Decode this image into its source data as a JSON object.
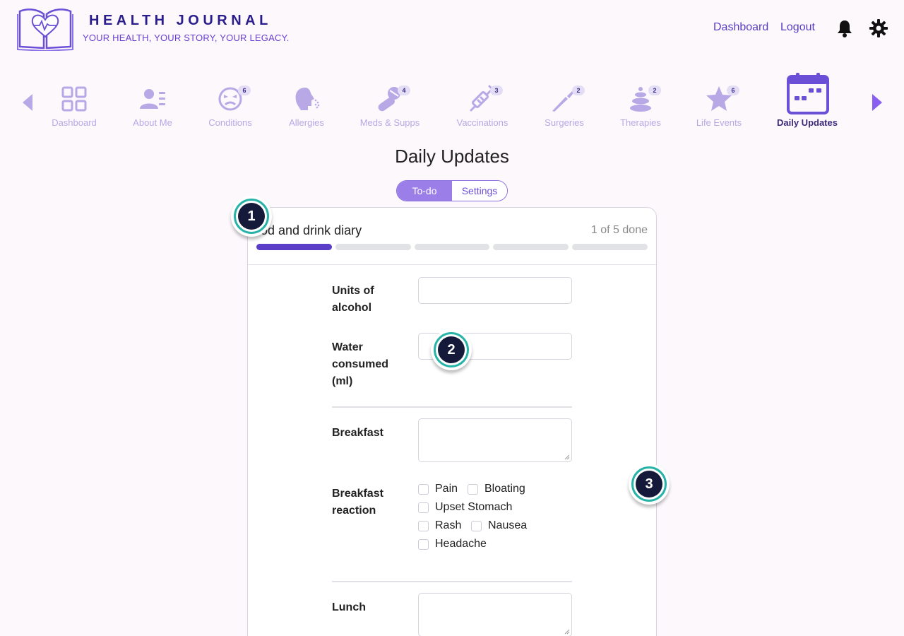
{
  "header": {
    "brand_title": "HEALTH JOURNAL",
    "tagline": "YOUR HEALTH, YOUR STORY, YOUR LEGACY.",
    "links": {
      "dashboard": "Dashboard",
      "logout": "Logout"
    }
  },
  "nav": {
    "items": [
      {
        "label": "Dashboard",
        "icon": "dashboard-icon",
        "badge": ""
      },
      {
        "label": "About Me",
        "icon": "user-card-icon",
        "badge": ""
      },
      {
        "label": "Conditions",
        "icon": "sick-face-icon",
        "badge": "6"
      },
      {
        "label": "Allergies",
        "icon": "sneeze-icon",
        "badge": ""
      },
      {
        "label": "Meds & Supps",
        "icon": "pills-icon",
        "badge": "4"
      },
      {
        "label": "Vaccinations",
        "icon": "syringe-icon",
        "badge": "3"
      },
      {
        "label": "Surgeries",
        "icon": "scalpel-icon",
        "badge": "2"
      },
      {
        "label": "Therapies",
        "icon": "stones-icon",
        "badge": "2"
      },
      {
        "label": "Life Events",
        "icon": "star-icon",
        "badge": "6"
      },
      {
        "label": "Daily Updates",
        "icon": "calendar-icon",
        "badge": ""
      }
    ]
  },
  "page_title": "Daily Updates",
  "tabs": {
    "todo": "To-do",
    "settings": "Settings",
    "active": "To-do"
  },
  "card": {
    "title": "od and drink diary",
    "progress_text": "1 of 5 done",
    "progress": {
      "done": 1,
      "total": 5
    },
    "fields": {
      "alcohol": {
        "label": "Units of alcohol",
        "value": ""
      },
      "water": {
        "label": "Water consumed (ml)",
        "value": ""
      },
      "breakfast": {
        "label": "Breakfast",
        "value": ""
      },
      "breakfast_reaction": {
        "label": "Breakfast reaction",
        "options": [
          "Pain",
          "Bloating",
          "Upset Stomach",
          "Rash",
          "Nausea",
          "Headache"
        ]
      },
      "lunch": {
        "label": "Lunch",
        "value": ""
      }
    }
  },
  "markers": [
    "1",
    "2",
    "3"
  ],
  "colors": {
    "accent": "#5a3ec8",
    "light_accent": "#b8a8e6",
    "marker_ring": "#27b3a8",
    "marker_fill": "#15193a"
  }
}
